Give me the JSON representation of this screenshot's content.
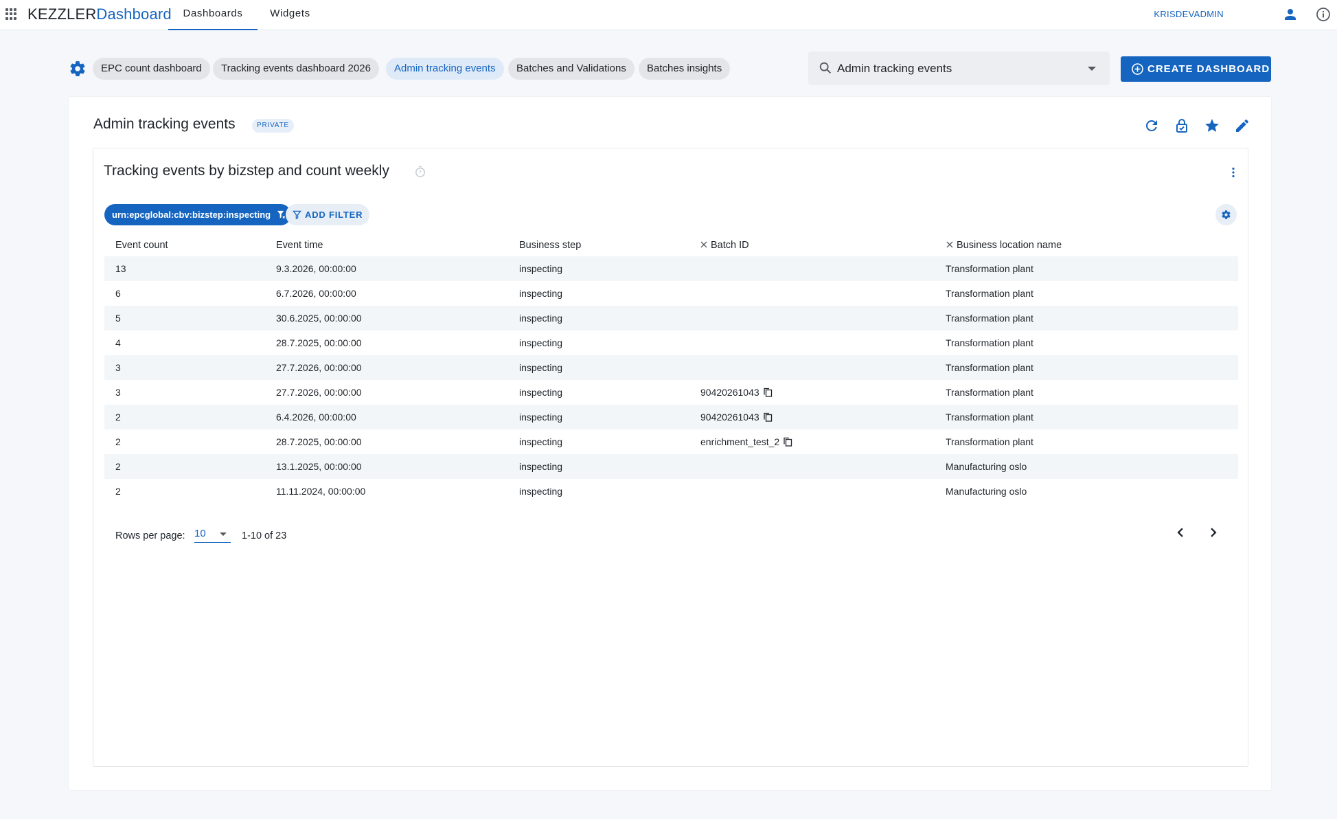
{
  "app": {
    "brand_part1": "KEZZLER",
    "brand_part2": "Dashboard",
    "nav": [
      {
        "label": "Dashboards",
        "active": true
      },
      {
        "label": "Widgets",
        "active": false
      }
    ],
    "user_name": "KRISDEVADMIN"
  },
  "dashboard_tabs": [
    {
      "label": "EPC count dashboard",
      "active": false
    },
    {
      "label": "Tracking events dashboard 2026",
      "active": false
    },
    {
      "label": "Admin tracking events",
      "active": true
    },
    {
      "label": "Batches and Validations",
      "active": false
    },
    {
      "label": "Batches insights",
      "active": false
    }
  ],
  "search": {
    "value": "Admin tracking events"
  },
  "create_button": {
    "label": "CREATE DASHBOARD"
  },
  "dashboard": {
    "title": "Admin tracking events",
    "visibility_badge": "PRIVATE"
  },
  "widget": {
    "title": "Tracking events by bizstep and count weekly",
    "active_filter": "urn:epcglobal:cbv:bizstep:inspecting",
    "add_filter_label": "ADD FILTER",
    "columns": [
      "Event count",
      "Event time",
      "Business step",
      "Batch ID",
      "Business location name"
    ],
    "rows": [
      {
        "count": "13",
        "time": "9.3.2026, 00:00:00",
        "step": "inspecting",
        "batch": "",
        "location": "Transformation plant"
      },
      {
        "count": "6",
        "time": "6.7.2026, 00:00:00",
        "step": "inspecting",
        "batch": "",
        "location": "Transformation plant"
      },
      {
        "count": "5",
        "time": "30.6.2025, 00:00:00",
        "step": "inspecting",
        "batch": "",
        "location": "Transformation plant"
      },
      {
        "count": "4",
        "time": "28.7.2025, 00:00:00",
        "step": "inspecting",
        "batch": "",
        "location": "Transformation plant"
      },
      {
        "count": "3",
        "time": "27.7.2026, 00:00:00",
        "step": "inspecting",
        "batch": "",
        "location": "Transformation plant"
      },
      {
        "count": "3",
        "time": "27.7.2026, 00:00:00",
        "step": "inspecting",
        "batch": "90420261043",
        "location": "Transformation plant"
      },
      {
        "count": "2",
        "time": "6.4.2026, 00:00:00",
        "step": "inspecting",
        "batch": "90420261043",
        "location": "Transformation plant"
      },
      {
        "count": "2",
        "time": "28.7.2025, 00:00:00",
        "step": "inspecting",
        "batch": "enrichment_test_2",
        "location": "Transformation plant"
      },
      {
        "count": "2",
        "time": "13.1.2025, 00:00:00",
        "step": "inspecting",
        "batch": "",
        "location": "Manufacturing oslo"
      },
      {
        "count": "2",
        "time": "11.11.2024, 00:00:00",
        "step": "inspecting",
        "batch": "",
        "location": "Manufacturing oslo"
      }
    ],
    "pagination": {
      "rows_per_page_label": "Rows per page:",
      "rows_per_page_value": "10",
      "range_text": "1-10 of 23"
    }
  },
  "colors": {
    "accent": "#1565c0",
    "chip_bg": "#e3e5e8",
    "row_stripe": "#f3f6f9"
  },
  "icons": [
    "apps-grid-icon",
    "user-icon",
    "info-icon",
    "gear-icon",
    "search-icon",
    "plus-circle-icon",
    "refresh-icon",
    "lock-check-icon",
    "star-icon",
    "edit-pencil-icon",
    "timer-icon",
    "kebab-menu-icon",
    "filter-icon",
    "close-icon",
    "copy-icon",
    "chevron-left-icon",
    "chevron-right-icon"
  ]
}
